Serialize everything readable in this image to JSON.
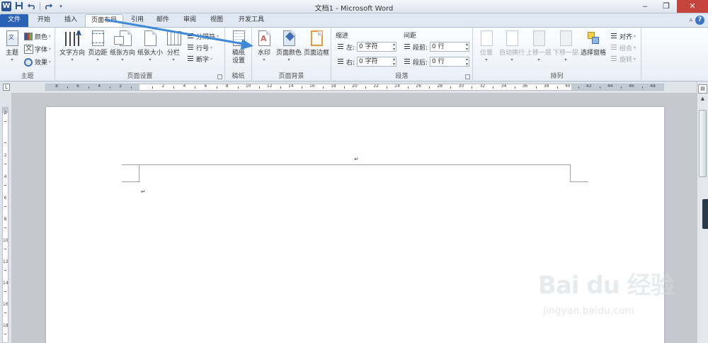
{
  "titlebar": {
    "app_icon": "W",
    "title": "文档1 - Microsoft Word",
    "qat": {
      "save_icon": "save-icon",
      "undo_icon": "undo-icon",
      "redo_icon": "redo-icon"
    },
    "controls": {
      "minimize": "‒",
      "restore": "❐",
      "close": "✕"
    }
  },
  "tabs": [
    "文件",
    "开始",
    "插入",
    "页面布局",
    "引用",
    "邮件",
    "审阅",
    "视图",
    "开发工具"
  ],
  "active_tab": "页面布局",
  "help_label": "?",
  "ribbon": {
    "themes": {
      "label": "主题",
      "theme_btn": "主题",
      "colors": "颜色",
      "fonts": "字体",
      "effects": "效果"
    },
    "page_setup": {
      "label": "页面设置",
      "text_direction": "文字方向",
      "margins": "页边距",
      "orientation": "纸张方向",
      "size": "纸张大小",
      "columns": "分栏",
      "breaks": "分隔符",
      "line_numbers": "行号",
      "hyphenation": "断字"
    },
    "manuscript": {
      "label": "稿纸",
      "setup_line1": "稿纸",
      "setup_line2": "设置"
    },
    "page_background": {
      "label": "页面背景",
      "watermark": "水印",
      "page_color": "页面颜色",
      "page_borders": "页面边框"
    },
    "paragraph": {
      "label": "段落",
      "indent_header": "缩进",
      "spacing_header": "间距",
      "left_label": "左:",
      "left_value": "0 字符",
      "right_label": "右:",
      "right_value": "0 字符",
      "before_label": "段前:",
      "before_value": "0 行",
      "after_label": "段后:",
      "after_value": "0 行"
    },
    "arrange": {
      "label": "排列",
      "position": "位置",
      "wrap_text": "自动换行",
      "bring_forward": "上移一层",
      "send_backward": "下移一层",
      "selection_pane": "选择窗格",
      "align": "对齐",
      "group": "组合",
      "rotate": "旋转"
    }
  },
  "ruler": {
    "corner": "L",
    "h_numbers": [
      "8",
      "6",
      "4",
      "2",
      "",
      "2",
      "4",
      "6",
      "8",
      "10",
      "12",
      "14",
      "16",
      "18",
      "20",
      "22",
      "24",
      "26",
      "28",
      "30",
      "32",
      "34",
      "36",
      "38",
      "40",
      "42",
      "44",
      "46",
      "48"
    ],
    "v_numbers": [
      "2",
      "",
      "2",
      "4",
      "6",
      "8",
      "10",
      "12",
      "14",
      "16",
      "18"
    ]
  },
  "document": {
    "para_mark_1": "↵",
    "para_mark_2": "↵"
  },
  "watermark": {
    "logo": "Bai du 经验",
    "url": "jingyan.baidu.com"
  },
  "colors": {
    "file_tab": "#2a63b5",
    "close_button": "#c7443c",
    "arrow": "#3d8bd8"
  }
}
